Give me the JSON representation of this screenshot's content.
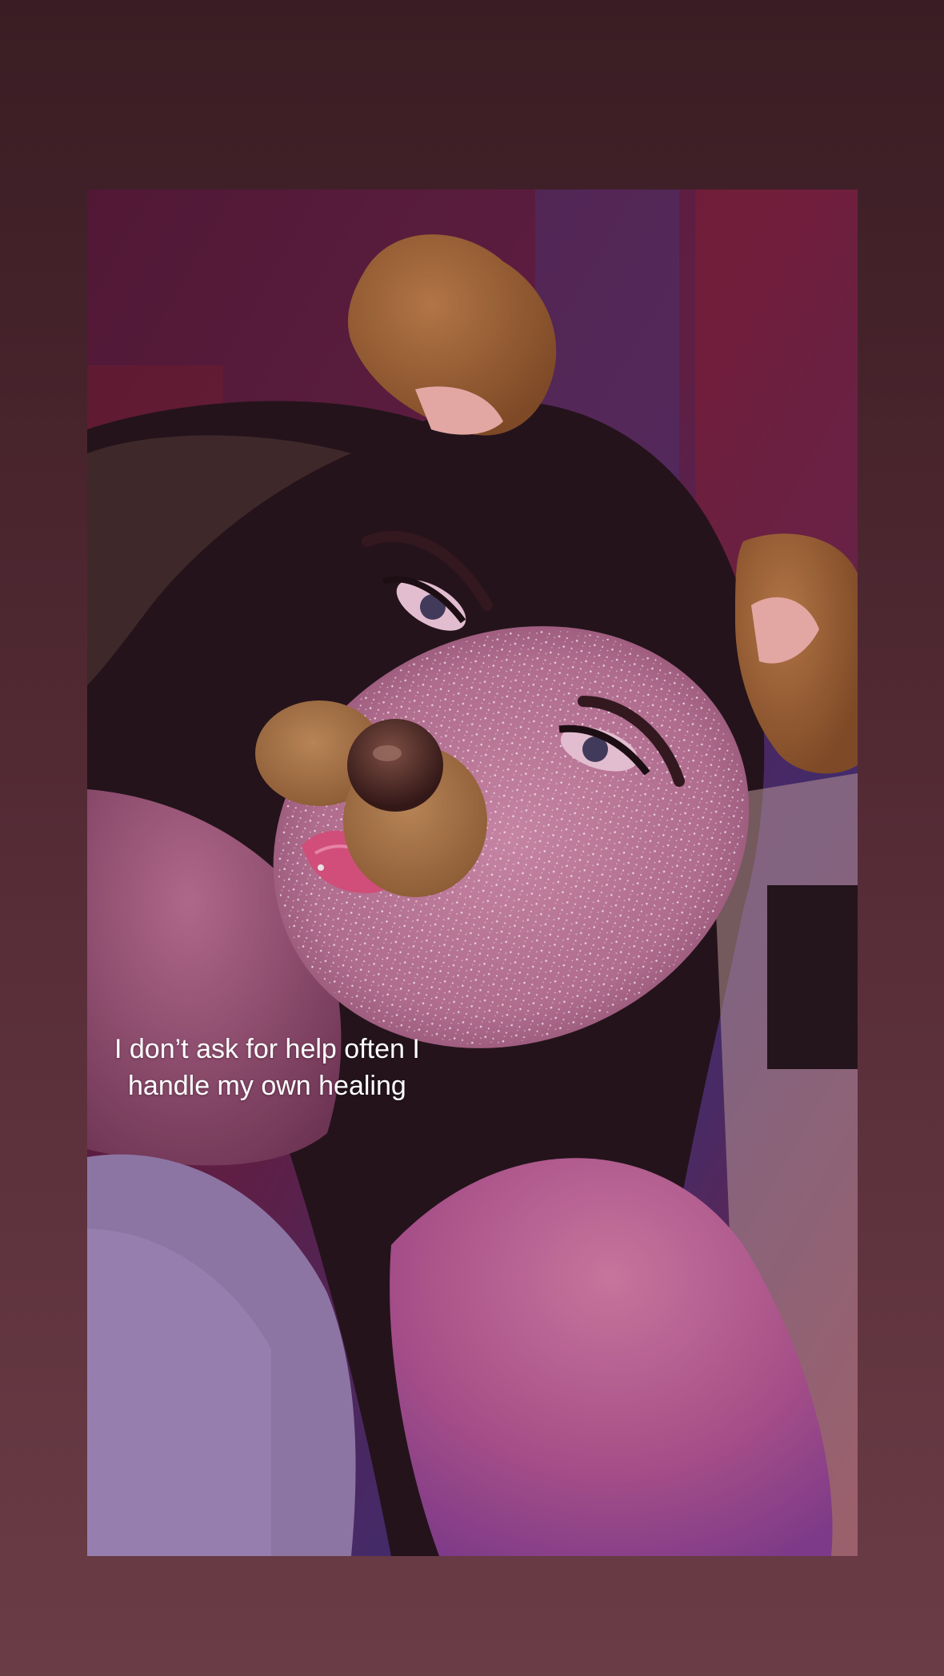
{
  "story": {
    "caption_line_1": "I don’t ask for help often I",
    "caption_line_2": "handle my own healing"
  },
  "colors": {
    "background_top": "#3a1d24",
    "background_bottom": "#6a3c46",
    "caption_text": "#ffffff",
    "filter_ear_brown": "#9b6431",
    "filter_nose_dark": "#3a2218"
  },
  "icons": {
    "filter_ears": "dog-ears-filter-icon",
    "filter_nose": "dog-nose-filter-icon"
  }
}
